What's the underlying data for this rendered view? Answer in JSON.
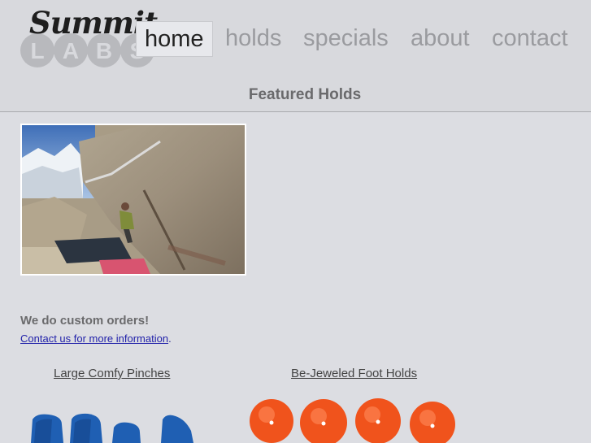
{
  "logo": {
    "script_text": "Summit",
    "block_text": "LABS"
  },
  "nav": {
    "items": [
      {
        "label": "home",
        "active": true
      },
      {
        "label": "holds",
        "active": false
      },
      {
        "label": "specials",
        "active": false
      },
      {
        "label": "about",
        "active": false
      },
      {
        "label": "contact",
        "active": false
      }
    ]
  },
  "featured": {
    "title": "Featured Holds"
  },
  "custom": {
    "heading": "We do custom orders!",
    "contact_link": "Contact us for more information",
    "contact_suffix": "."
  },
  "products": [
    {
      "label": "Large Comfy Pinches"
    },
    {
      "label": "Be-Jeweled Foot Holds"
    }
  ],
  "colors": {
    "background": "#dcdde2",
    "link": "#2222aa",
    "nav_inactive": "#9a9b9f",
    "nav_active_text": "#222222",
    "blue_holds": "#1f5fb3",
    "orange_holds": "#f0531c"
  }
}
